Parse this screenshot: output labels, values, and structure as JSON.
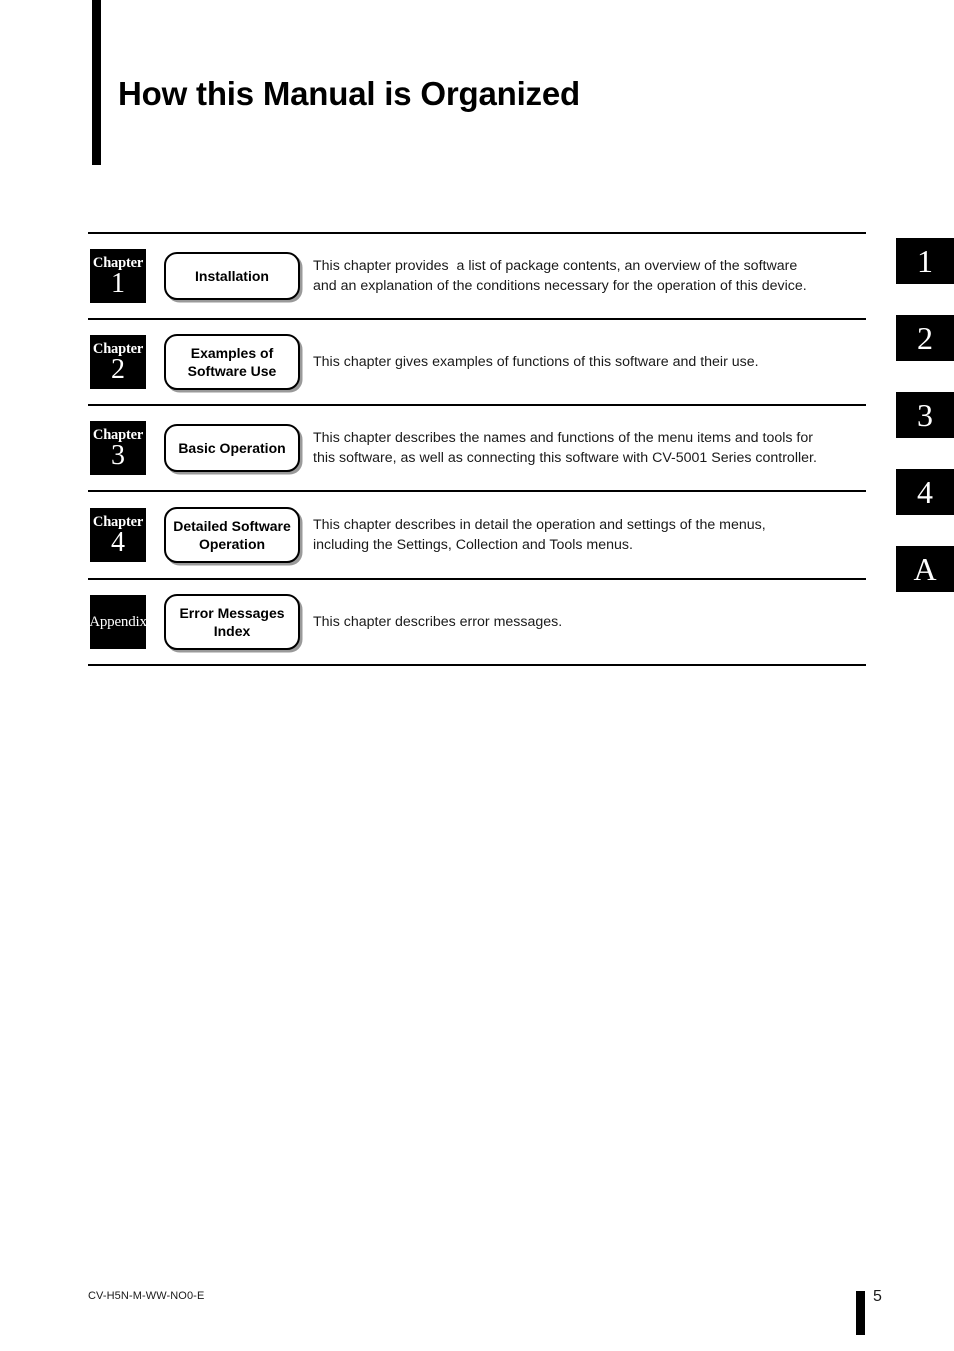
{
  "page": {
    "title": "How this Manual is Organized",
    "document_code": "CV-H5N-M-WW-NO0-E",
    "page_number": "5"
  },
  "chapters": [
    {
      "badge_word": "Chapter",
      "badge_number": "1",
      "label": "Installation",
      "label_lines": [
        "Installation"
      ],
      "description_lines": [
        "This chapter provides  a list of package contents, an overview of the software",
        "and an explanation of the conditions necessary for the operation of this device."
      ]
    },
    {
      "badge_word": "Chapter",
      "badge_number": "2",
      "label": "Examples of Software Use",
      "label_lines": [
        "Examples of",
        "Software Use"
      ],
      "description_lines": [
        "This chapter gives examples of functions of this software and their use."
      ]
    },
    {
      "badge_word": "Chapter",
      "badge_number": "3",
      "label": "Basic Operation",
      "label_lines": [
        "Basic Operation"
      ],
      "description_lines": [
        "This chapter describes the names and functions of the menu items and tools for",
        "this software, as well as connecting this software with CV-5001 Series controller."
      ]
    },
    {
      "badge_word": "Chapter",
      "badge_number": "4",
      "label": "Detailed Software Operation",
      "label_lines": [
        "Detailed Software",
        "Operation"
      ],
      "description_lines": [
        "This chapter describes in detail the operation and settings of the menus,",
        "including the Settings, Collection and Tools menus."
      ]
    },
    {
      "badge_word": "Appendix",
      "badge_number": "",
      "label": "Error Messages Index",
      "label_lines": [
        "Error Messages",
        "Index"
      ],
      "description_lines": [
        "This chapter describes error messages."
      ]
    }
  ],
  "tab_markers": [
    "1",
    "2",
    "3",
    "4",
    "A"
  ],
  "colors": {
    "ink": "#000000",
    "paper": "#ffffff",
    "body_text": "#1a1a1a"
  }
}
